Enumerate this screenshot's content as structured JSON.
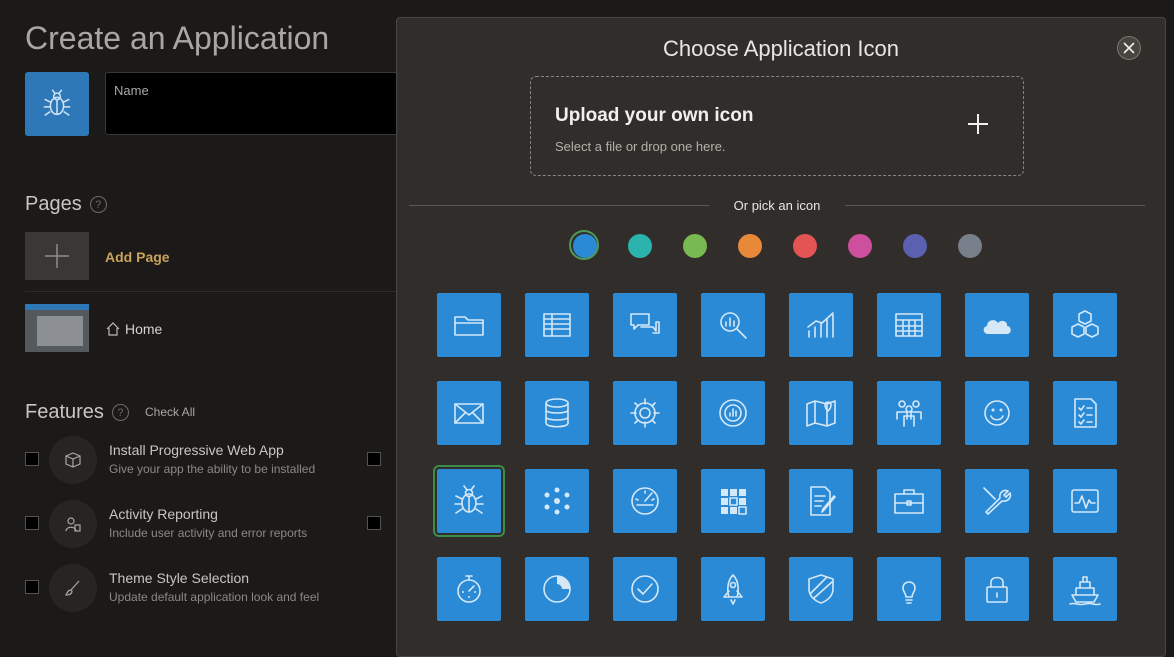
{
  "page": {
    "title": "Create an Application",
    "name_label": "Name",
    "name_value": "",
    "app_icon": "bug-icon"
  },
  "pages_section": {
    "title": "Pages",
    "add_page_label": "Add Page",
    "pages": [
      {
        "label": "Home",
        "icon": "home-icon"
      }
    ]
  },
  "features_section": {
    "title": "Features",
    "check_all_label": "Check All",
    "items": [
      {
        "name": "Install Progressive Web App",
        "description": "Give your app the ability to be installed",
        "icon": "box-icon"
      },
      {
        "name": "Activity Reporting",
        "description": "Include user activity and error reports",
        "icon": "user-report-icon"
      },
      {
        "name": "Theme Style Selection",
        "description": "Update default application look and feel",
        "icon": "brush-icon"
      }
    ]
  },
  "modal": {
    "title": "Choose Application Icon",
    "upload_title": "Upload your own icon",
    "upload_subtitle": "Select a file or drop one here.",
    "or_label": "Or pick an icon",
    "colors": [
      "#2a8ad6",
      "#2bb3ad",
      "#79b951",
      "#e8893a",
      "#e45454",
      "#cf4f9f",
      "#5b60b0",
      "#77808a"
    ],
    "selected_color_index": 0,
    "tile_color": "#2a8ad6",
    "selected_icon_index": 16,
    "icons": [
      "folder-icon",
      "table-icon",
      "chat-icon",
      "search-chart-icon",
      "bar-chart-icon",
      "calendar-grid-icon",
      "cloud-icon",
      "cubes-icon",
      "mail-icon",
      "database-icon",
      "gear-icon",
      "donut-chart-icon",
      "map-pin-icon",
      "people-icon",
      "smiley-icon",
      "checklist-icon",
      "bug-icon",
      "dots-network-icon",
      "gauge-icon",
      "grid-icon",
      "edit-document-icon",
      "briefcase-icon",
      "tools-icon",
      "pulse-icon",
      "stopwatch-icon",
      "pie-chart-icon",
      "check-circle-icon",
      "rocket-icon",
      "shield-icon",
      "lightbulb-icon",
      "lock-icon",
      "ship-icon"
    ]
  }
}
